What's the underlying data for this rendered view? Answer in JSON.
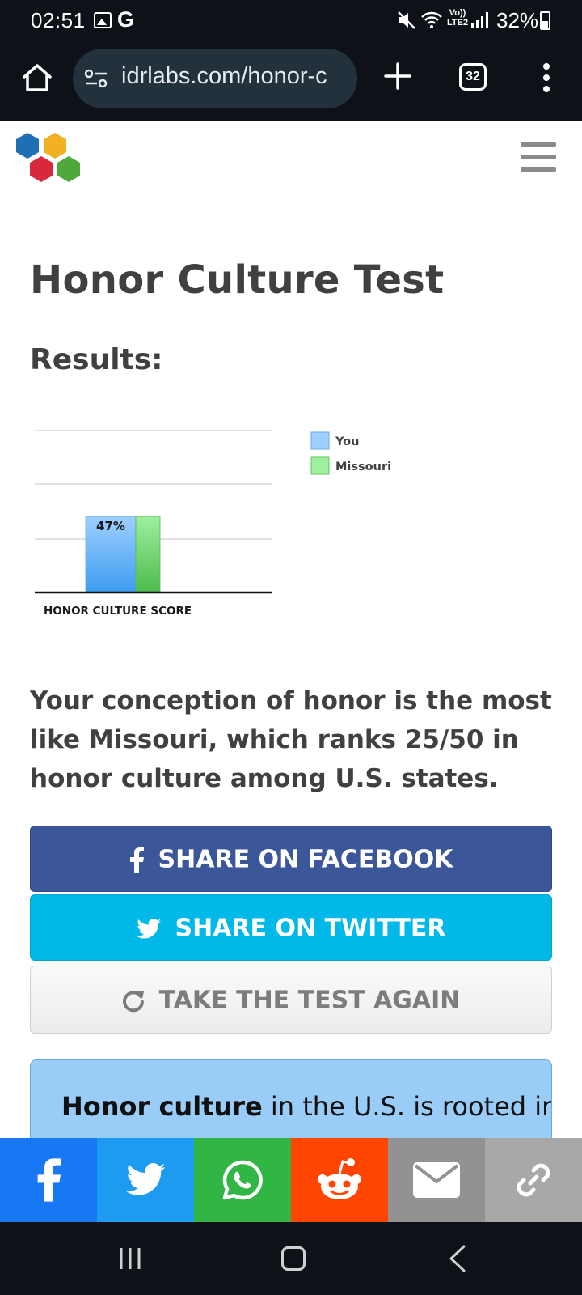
{
  "status_bar": {
    "time": "02:51",
    "battery": "32%",
    "volte": "Vo))\nLTE2",
    "icons": [
      "gallery-icon",
      "google-icon",
      "mute-icon",
      "wifi-icon",
      "signal-icon",
      "battery-icon"
    ]
  },
  "browser": {
    "url": "idrlabs.com/honor-c",
    "tab_count": "32",
    "icons": [
      "home-icon",
      "site-info-icon",
      "new-tab-icon",
      "menu-dots-icon"
    ]
  },
  "page": {
    "title": "Honor Culture Test",
    "results_heading": "Results:",
    "result_text": "Your conception of honor is the most like Missouri, which ranks 25/50 in honor culture among U.S. states.",
    "buttons": {
      "facebook": "SHARE ON FACEBOOK",
      "twitter": "SHARE ON TWITTER",
      "retake": "TAKE THE TEST AGAIN"
    },
    "info": {
      "bold": "Honor culture",
      "rest": " in the U.S. is rooted in"
    }
  },
  "chart_data": {
    "type": "bar",
    "categories": [
      "HONOR CULTURE SCORE"
    ],
    "series": [
      {
        "name": "You",
        "values": [
          47
        ],
        "color": "#61b3ff"
      },
      {
        "name": "Missouri",
        "values": [
          47
        ],
        "color": "#6fd46f"
      }
    ],
    "data_labels": [
      "47%"
    ],
    "ylim": [
      0,
      100
    ],
    "grid": true,
    "legend": "right"
  },
  "share_strip": [
    {
      "name": "facebook",
      "color": "#1877f2",
      "icon": "facebook-icon"
    },
    {
      "name": "twitter",
      "color": "#1d9bf0",
      "icon": "twitter-icon"
    },
    {
      "name": "whatsapp",
      "color": "#31b545",
      "icon": "whatsapp-icon"
    },
    {
      "name": "reddit",
      "color": "#ff4500",
      "icon": "reddit-icon"
    },
    {
      "name": "email",
      "color": "#929292",
      "icon": "email-icon"
    },
    {
      "name": "copy-link",
      "color": "#a8a8a8",
      "icon": "link-icon"
    }
  ],
  "nav_bar": {
    "icons": [
      "recent-apps-icon",
      "home-icon",
      "back-icon"
    ]
  }
}
